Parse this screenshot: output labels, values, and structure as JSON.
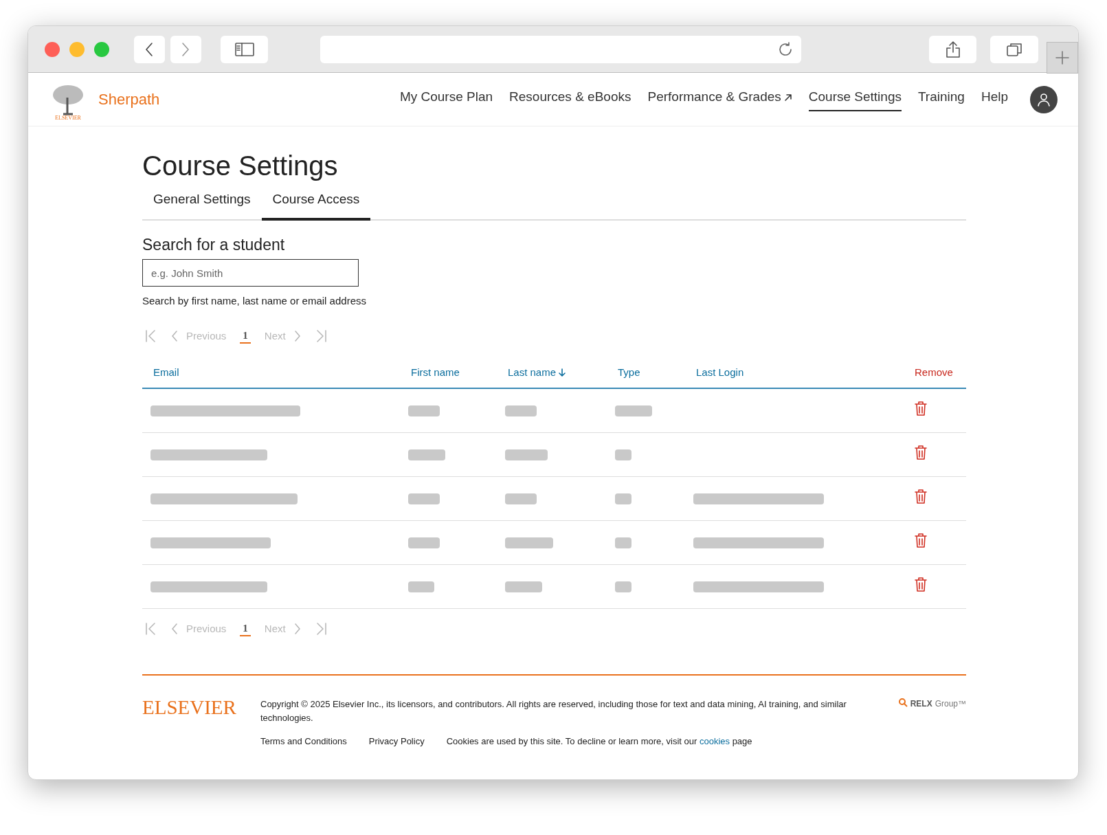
{
  "brand": {
    "name": "Sherpath",
    "publisher": "ELSEVIER"
  },
  "nav": [
    {
      "label": "My Course Plan",
      "selected": false,
      "external": false
    },
    {
      "label": "Resources & eBooks",
      "selected": false,
      "external": false
    },
    {
      "label": "Performance & Grades",
      "selected": false,
      "external": true
    },
    {
      "label": "Course Settings",
      "selected": true,
      "external": false
    },
    {
      "label": "Training",
      "selected": false,
      "external": false
    },
    {
      "label": "Help",
      "selected": false,
      "external": false
    }
  ],
  "page_title": "Course Settings",
  "tabs": [
    {
      "label": "General Settings",
      "selected": false
    },
    {
      "label": "Course Access",
      "selected": true
    }
  ],
  "search": {
    "label": "Search for a student",
    "placeholder": "e.g. John Smith",
    "hint": "Search by first name, last name or email address"
  },
  "pagination_top": {
    "previous": "Previous",
    "page": "1",
    "next": "Next"
  },
  "table": {
    "columns": [
      {
        "label": "Email",
        "sorted": false,
        "kind": "text"
      },
      {
        "label": "First name",
        "sorted": false,
        "kind": "text"
      },
      {
        "label": "Last name",
        "sorted": true,
        "kind": "text"
      },
      {
        "label": "Type",
        "sorted": false,
        "kind": "text"
      },
      {
        "label": "Last Login",
        "sorted": false,
        "kind": "text"
      },
      {
        "label": "Remove",
        "sorted": false,
        "kind": "action"
      }
    ],
    "rows": [
      {
        "has_last_login": false
      },
      {
        "has_last_login": false
      },
      {
        "has_last_login": true
      },
      {
        "has_last_login": true
      },
      {
        "has_last_login": true
      }
    ]
  },
  "pagination_bottom": {
    "previous": "Previous",
    "page": "1",
    "next": "Next"
  },
  "footer": {
    "logo": "ELSEVIER",
    "copyright": "Copyright © 2025 Elsevier Inc., its licensors, and contributors. All rights are reserved, including those for text and data mining, AI training, and similar technologies.",
    "links": [
      "Terms and Conditions",
      "Privacy Policy"
    ],
    "cookie_text": "Cookies are used by this site. To decline or learn more, visit our",
    "cookie_link": "cookies",
    "cookie_end": "page",
    "group_logo": "RELX",
    "group_logo_suffix": "Group™"
  }
}
